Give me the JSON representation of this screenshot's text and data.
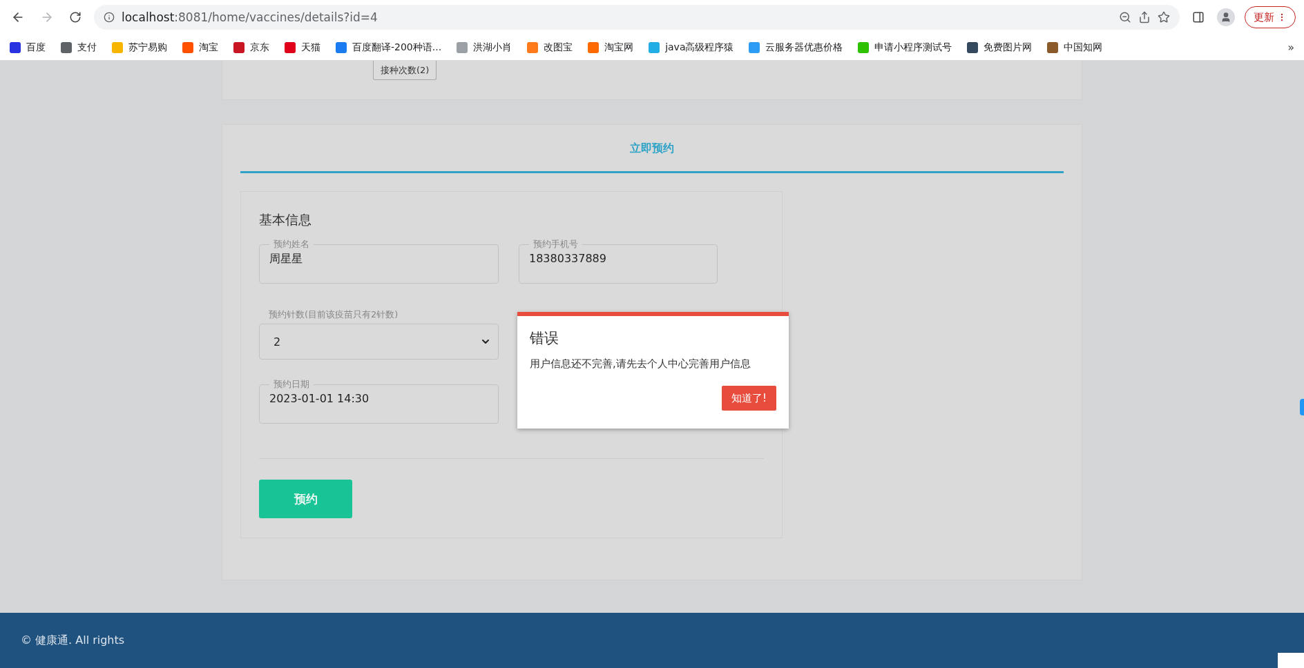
{
  "browser": {
    "url_host": "localhost",
    "url_path": ":8081/home/vaccines/details?id=4",
    "update_button": "更新",
    "bookmarks": [
      {
        "label": "百度",
        "color": "#2932e1"
      },
      {
        "label": "支付",
        "color": "#5f6368"
      },
      {
        "label": "苏宁易购",
        "color": "#f7b500"
      },
      {
        "label": "淘宝",
        "color": "#ff5000"
      },
      {
        "label": "京东",
        "color": "#c91623"
      },
      {
        "label": "天猫",
        "color": "#e1001a"
      },
      {
        "label": "百度翻译-200种语...",
        "color": "#1a7cf0"
      },
      {
        "label": "洪湖小肖",
        "color": "#9aa0a6"
      },
      {
        "label": "改图宝",
        "color": "#ff7a1a"
      },
      {
        "label": "淘宝网",
        "color": "#ff6a00"
      },
      {
        "label": "java高级程序猿",
        "color": "#23ade5"
      },
      {
        "label": "云服务器优惠价格",
        "color": "#2b9bf4"
      },
      {
        "label": "申请小程序测试号",
        "color": "#2dc100"
      },
      {
        "label": "免费图片网",
        "color": "#34495e"
      },
      {
        "label": "中国知网",
        "color": "#8a5a2b"
      }
    ],
    "bookmarks_more": "»"
  },
  "top_card": {
    "dose_button": "接种次数(2)"
  },
  "tabs": [
    {
      "label": "立即预约",
      "selected": true
    }
  ],
  "form": {
    "title": "基本信息",
    "fields": [
      {
        "kind": "input",
        "label": "预约姓名",
        "value": "周星星"
      },
      {
        "kind": "input",
        "label": "预约手机号",
        "value": "18380337889"
      },
      {
        "kind": "select",
        "label": "预约针数(目前该疫苗只有2针数)",
        "value": "2"
      },
      {
        "kind": "input",
        "label": "预约日期",
        "value": "2023-01-01 14:30"
      }
    ],
    "submit": "预约"
  },
  "dialog": {
    "title": "错误",
    "message": "用户信息还不完善,请先去个人中心完善用户信息",
    "button": "知道了!"
  },
  "footer": {
    "copyright": "© 健康通. All rights"
  }
}
